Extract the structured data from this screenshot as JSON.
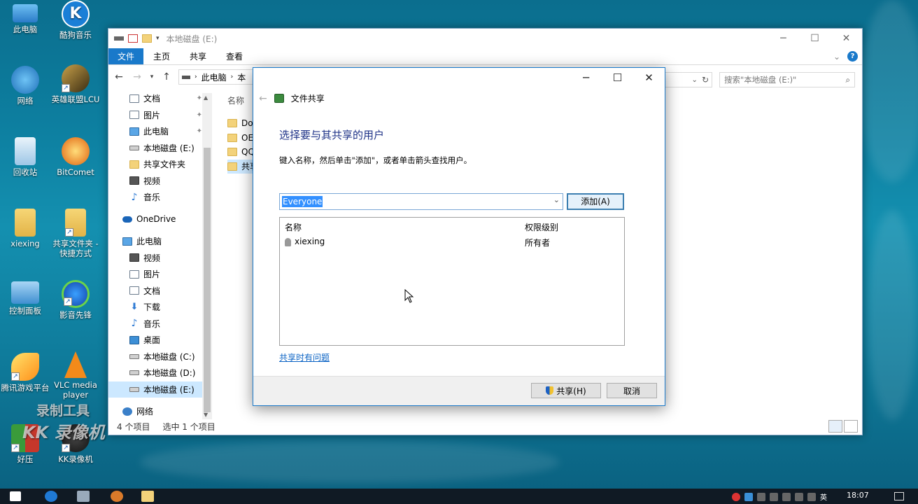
{
  "desktop": {
    "icons": [
      {
        "label": "此电脑"
      },
      {
        "label": "酷狗音乐"
      },
      {
        "label": "网络"
      },
      {
        "label": "英雄联盟LCU"
      },
      {
        "label": "回收站"
      },
      {
        "label": "BitComet"
      },
      {
        "label": "xiexing"
      },
      {
        "label": "共享文件夹 - 快捷方式"
      },
      {
        "label": "控制面板"
      },
      {
        "label": "影音先锋"
      },
      {
        "label": "腾讯游戏平台"
      },
      {
        "label": "VLC media player"
      },
      {
        "label": "好压"
      },
      {
        "label": "KK录像机"
      }
    ],
    "kugou_glyph": "K"
  },
  "explorer": {
    "title": "本地磁盘 (E:)",
    "ribbon_tabs": [
      "文件",
      "主页",
      "共享",
      "查看"
    ],
    "address": {
      "segment1": "此电脑",
      "segment2": "本"
    },
    "search_placeholder": "搜索\"本地磁盘 (E:)\"",
    "nav_items": [
      {
        "label": "文档",
        "icon": "doc-icon",
        "pinned": true
      },
      {
        "label": "图片",
        "icon": "image-icon",
        "pinned": true
      },
      {
        "label": "此电脑",
        "icon": "pc-icon",
        "pinned": true
      },
      {
        "label": "本地磁盘 (E:)",
        "icon": "drive-icon"
      },
      {
        "label": "共享文件夹",
        "icon": "folder-icon"
      },
      {
        "label": "视频",
        "icon": "video-icon"
      },
      {
        "label": "音乐",
        "icon": "music-icon"
      },
      {
        "label": "OneDrive",
        "icon": "cloud-icon"
      },
      {
        "label": "此电脑",
        "icon": "pc-icon"
      },
      {
        "label": "视频",
        "icon": "video-icon"
      },
      {
        "label": "图片",
        "icon": "image-icon"
      },
      {
        "label": "文档",
        "icon": "doc-icon"
      },
      {
        "label": "下载",
        "icon": "download-icon"
      },
      {
        "label": "音乐",
        "icon": "music-icon"
      },
      {
        "label": "桌面",
        "icon": "desktop-icon"
      },
      {
        "label": "本地磁盘 (C:)",
        "icon": "drive-icon"
      },
      {
        "label": "本地磁盘 (D:)",
        "icon": "drive-icon"
      },
      {
        "label": "本地磁盘 (E:)",
        "icon": "drive-icon",
        "selected": true
      },
      {
        "label": "网络",
        "icon": "network-icon"
      }
    ],
    "column_header": "名称",
    "files": [
      {
        "name": "Do"
      },
      {
        "name": "OE"
      },
      {
        "name": "QQ"
      },
      {
        "name": "共享",
        "selected": true
      }
    ],
    "status": {
      "item_count": "4 个项目",
      "selection": "选中 1 个项目"
    }
  },
  "share_dialog": {
    "header": "文件共享",
    "title": "选择要与其共享的用户",
    "instruction": "键入名称，然后单击\"添加\"，或者单击箭头查找用户。",
    "name_input_value": "Everyone",
    "add_button": "添加(A)",
    "columns": {
      "name": "名称",
      "permission": "权限级别"
    },
    "users": [
      {
        "name": "xiexing",
        "permission": "所有者"
      }
    ],
    "trouble_link": "共享时有问题",
    "share_button": "共享(H)",
    "cancel_button": "取消"
  },
  "watermark": {
    "line1": "录制工具",
    "line2": "KK 录像机"
  },
  "taskbar": {
    "time": "18:07",
    "ime": "英"
  }
}
